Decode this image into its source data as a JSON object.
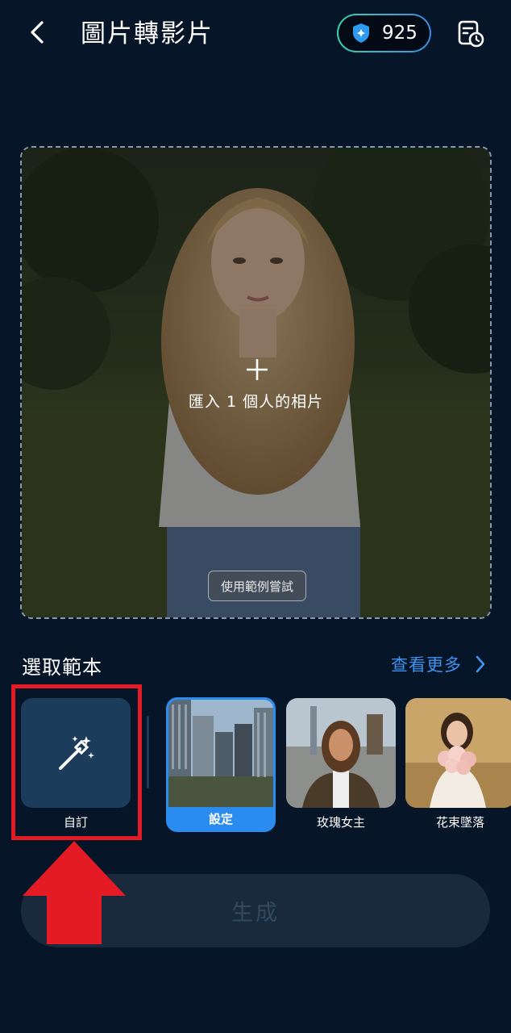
{
  "header": {
    "title": "圖片轉影片",
    "credits": "925"
  },
  "upload": {
    "prompt": "匯入 1 個人的相片",
    "example_button": "使用範例嘗試"
  },
  "templates": {
    "section_title": "選取範本",
    "more_link": "查看更多",
    "items": [
      {
        "label": "自訂",
        "icon": "magic-wand-icon"
      },
      {
        "label": "設定",
        "selected": true
      },
      {
        "label": "玫瑰女主"
      },
      {
        "label": "花束墜落"
      }
    ]
  },
  "generate_button": "生成",
  "colors": {
    "background": "#071528",
    "accent": "#2b8cf0",
    "highlight": "#e41b25"
  }
}
